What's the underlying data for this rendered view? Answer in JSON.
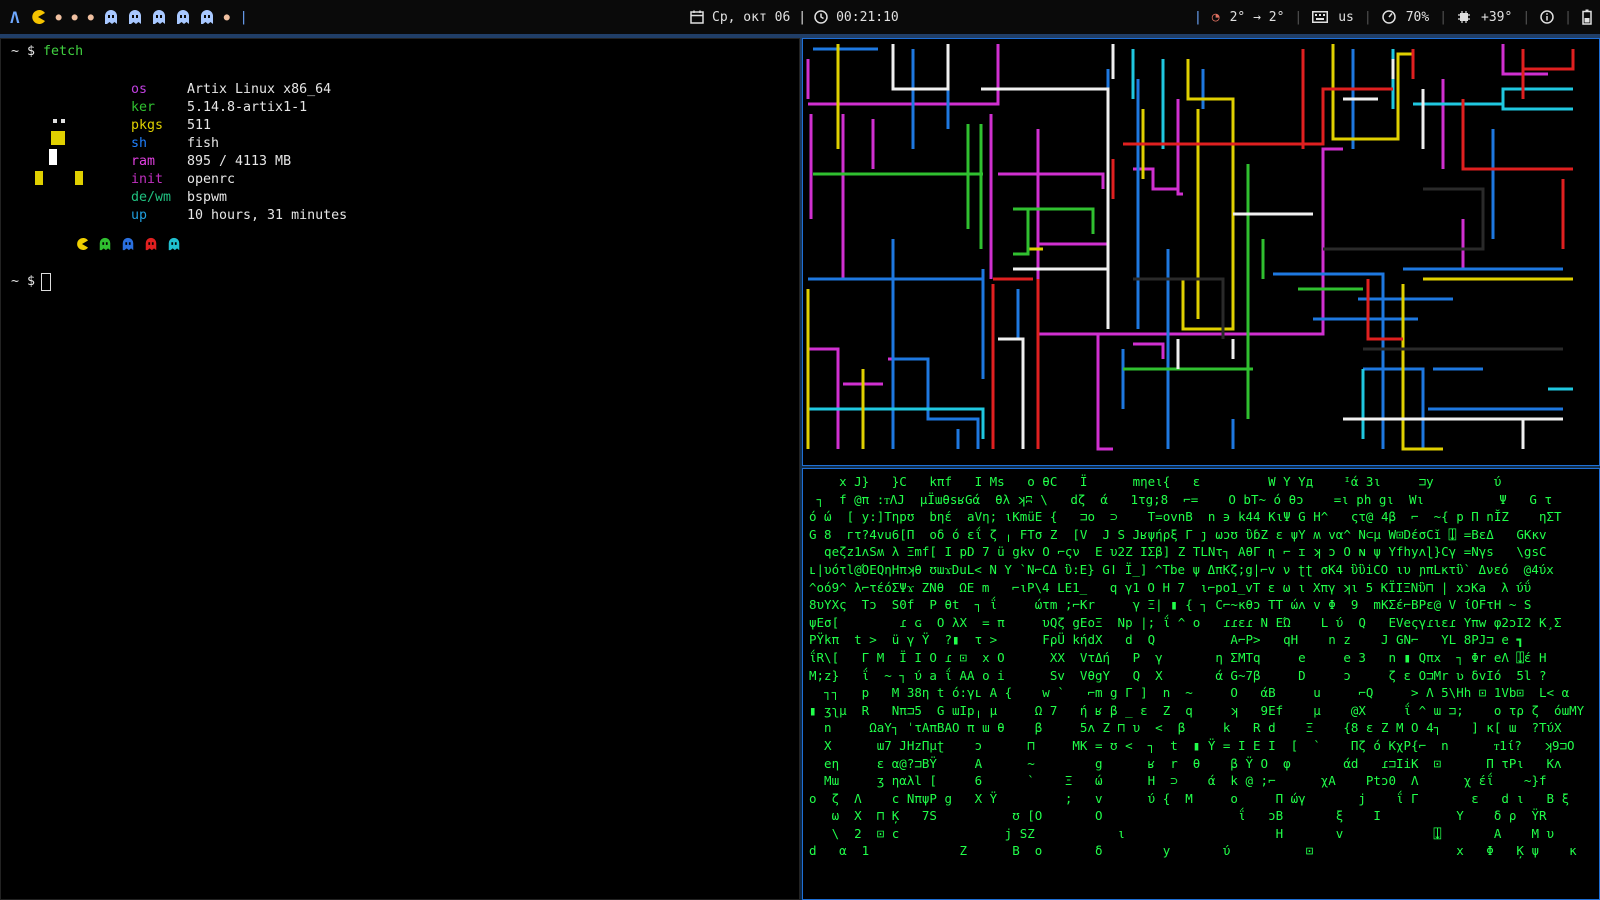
{
  "bar": {
    "logo": "Λ",
    "date": "Ср, окт 06",
    "time": "00:21:10",
    "temp_range": "2° → 2°",
    "keyboard": "us",
    "volume": "70%",
    "cpu_temp": "+39°"
  },
  "terminal": {
    "prompt_symbol": "~ $",
    "command": "fetch",
    "fetch": [
      {
        "key": "os",
        "value": "Artix Linux x86_64",
        "color": "#c040e0"
      },
      {
        "key": "ker",
        "value": "5.14.8-artix1-1",
        "color": "#30c030"
      },
      {
        "key": "pkgs",
        "value": "511",
        "color": "#e0d000"
      },
      {
        "key": "sh",
        "value": "fish",
        "color": "#2080ff"
      },
      {
        "key": "ram",
        "value": "895 / 4113 MB",
        "color": "#e040e0"
      },
      {
        "key": "init",
        "value": "openrc",
        "color": "#c030c0"
      },
      {
        "key": "de/wm",
        "value": "bspwm",
        "color": "#20c080"
      },
      {
        "key": "up",
        "value": "10 hours, 31 minutes",
        "color": "#20a0e0"
      }
    ],
    "second_prompt": "~ $"
  },
  "matrix": {
    "lines": [
      "    x J}   }C   kπf   I Ms   o θC   Ï      mηeι{   ε         W Y Yд    ᴵά 3ι     ⊐y        ύ",
      " ┐  f @π :ᴛΛJ  μÏɯθsʁGά  θλ ʞʭ \\   dζ  ά   1τg;8  ⌐=    O bT~ ό θɔ    =ι ph gι  Wι          Ψ   G τ",
      "ό ώ  [ y:]Tηpʊ  bηέ  aVη; ιΚmüE {   ⊐ο  ⊃    T=ovnB  n ϶ k44 KιΨ G H^   ςτ@ 4β  ⌐  ~{ p Π nĬZ    ηΣΤ",
      "G 8  гτ?4vu6[Π  οδ ό εΐ ζ ╷ FΤσ Z  [V  J S Jʁψήρξ Γ ȷ ωɔʊ ὓɓZ ε ψY ʍ vα^ N⊂μ W⊡DέσCĭ ⍗ =ΒεΔ   GKκv",
      "  qeζz1ʌSʍ λ Ξmf[ I pD 7 ü gkv O ⌐ςν  E υ2Z ΙΣβ] Z TLNτ┐ AθΓ ɳ ⌐ ɪ ʞ ɔ O ɴ ψ Yfhyʌɭ}Cγ =Nγs   \\gsC",
      "ʟ|υότl@ΌEQηHπʞθ ʊɯϫDuL< N Y `N⌐CΔ ὓ:Ε} Gǀ Ϊ_] ^Tbe ψ ΔπΚζ;g|⌐v ν ʈʈ σK4 ὓὓiCO ιυ ɲπLκτὓ` Δνεό  @4ύx",
      "^οό9^ λ⌐τέόΣΨϫ ZNθ  ΩΕ m   ⌐ιΡ\\4 LΕ1_   q γ1 O H 7  ι⌐po1_vT ε ω ι Xπγ ʞι 5 ΚΪΙΞΝὓ⊓ | xɔKa  λ ύΰ",
      "8υYXς  Tɔ  S0f  P θt  ┐ ΐ     ώτm ;⌐Κr     γ Ξ| ▮ { ┐ C⌐~κθɔ ΤΤ ώʌ v Φ  9  mΚΣέ⌐BΡε@ V ίOFτH ~ S",
      "ψΕσ[        ɾ ɢ  O λX  = π     υQζ gΕoΞ  Np |; ΐ ^ o   ɾɾɛɾ N ΕΏ    L ύ  Q   ΕVeςγɾɩɛɾ Υπw φ2ɔΙ2 Κ̧ Σ",
      "ΡŸkπ  t >  ü γ Ϋ  ?▮  τ >      FρÜ kήdX   d  Q          Α⌐P>   qH    n z    J GN⌐   ΥL 8ΡJ⊐ e ┓",
      "ΐR\\[   Γ M  Ϊ Ι O ɾ ⊡  x O      XX  VτΔή   P  γ       η ΣΜΤq     e     e 3   n ▮ Qπx  ┐ Φr eΛ ⍗έ H",
      "M;z}   ΐ  ~ ┐ ύ a ΐ ΑΑ o i      Sv  VθgY   Q  X       ά G~7β     D     ɔ     ζ ɛ O⊐Mr ʋ δvΙό  5l ?",
      "  ┐┐   p   M 38η t ό:γʟ A {    w `   ⌐m g Γ ]  n  ~     O   άB     u     ⌐Q     > Λ 5\\Hh ⊡ 1Vb⊡  L< α",
      "▮ ʒʅμ  R   Nπ⊐5  G ɯIp╷ μ     Ω 7   ή ʁ β _ ε  Z  q     ʞ   9Εf    μ    @X     ΐ ^ ɯ ⊐;    ο τρ ζ  όɯMY",
      "  n     ΩaΥ┐ ˈτΑπBAO π ɯ θ    β     5ʌ Z ⊓ υ  <  β     k   R d    Ξ    {8 ε Z M O 4┐    ] κ[ ɯ  ?ΤύΧ",
      "  X      ɯ7 JHzΠμʈ    ɔ      ⊓     MK = ʊ <  ┐  t  ▮ Ϋ = Ι Ε Ι  [  `    Πζ ό ΚχΡ{⌐  n      ᴛ1ί?   ʞ9⊐O",
      "  eη     ε α@?⊐BΫ     Α      ~        g      ʁ  r  θ    β Ϋ O  φ       άd   ɾ⊐IiK  ⊡      Π τΡι   Kʌ",
      "  Mɯ     ʒ ηαλl [     6      `    Ξ   ώ      H  ⊃    ά  k @ ;⌐      χΑ    Ρtɔ0  Λ      χ έΐ    ~}f",
      "o  ζ  Λ    c NπψΡ g   X Ϋ         ;   v      ύ {  M     ο     Π ώγ       j    ΐ Γ       ε   d ι   Β ξ",
      "   ω  X  ⊓ Ķ   7S          ʊ [O       O                  ΐ   ɔΒ       ξ    Ι          Y    δ ρ  ΫR",
      "   \\  2  ⊡ c              j SZ           ι                    H       v            ⍗       Α    M υ",
      "d   α  1            Z      B  o       δ        y       ύ          ⊡                   x   Φ   Ķ ψ    κ"
    ]
  }
}
